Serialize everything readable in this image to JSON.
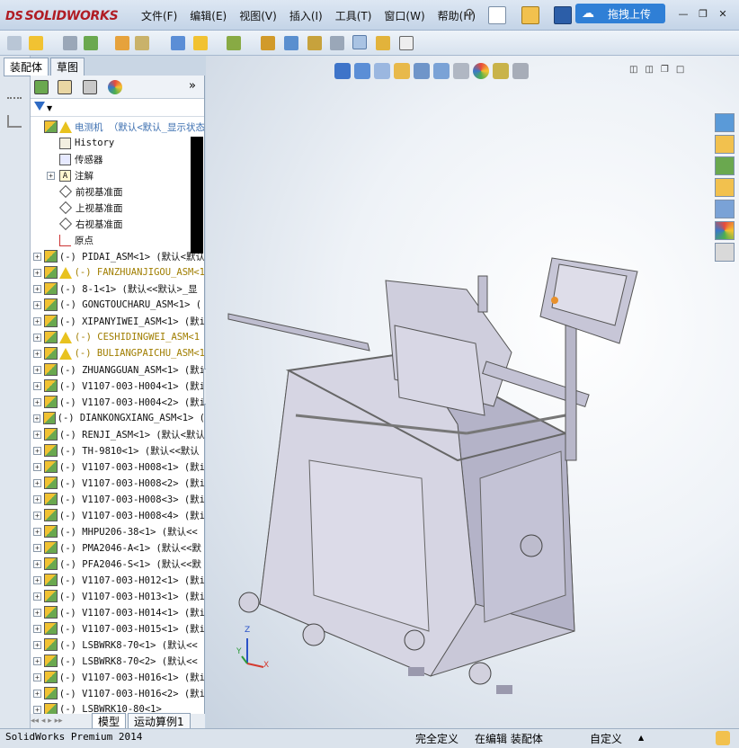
{
  "app": {
    "logo_text": "SOLIDWORKS",
    "logo_mark": "DS"
  },
  "menu": [
    "文件(F)",
    "编辑(E)",
    "视图(V)",
    "插入(I)",
    "工具(T)",
    "窗口(W)",
    "帮助(H)"
  ],
  "upload_button": "拖拽上传",
  "panel_tabs": [
    "装配体",
    "草图"
  ],
  "tree": [
    {
      "text": "电测机  （默认<默认_显示状态",
      "icon": "assembly-warning",
      "plus": false,
      "style": "blue"
    },
    {
      "text": "History",
      "icon": "history",
      "plus": false,
      "indent": 1
    },
    {
      "text": "传感器",
      "icon": "sensor",
      "plus": false,
      "indent": 1
    },
    {
      "text": "注解",
      "icon": "annotation",
      "plus": true,
      "indent": 1
    },
    {
      "text": "前视基准面",
      "icon": "plane",
      "plus": false,
      "indent": 1
    },
    {
      "text": "上视基准面",
      "icon": "plane",
      "plus": false,
      "indent": 1
    },
    {
      "text": "右视基准面",
      "icon": "plane",
      "plus": false,
      "indent": 1
    },
    {
      "text": "原点",
      "icon": "origin",
      "plus": false,
      "indent": 1
    },
    {
      "text": "(-) PIDAI_ASM<1> (默认<默认",
      "icon": "part",
      "plus": true
    },
    {
      "text": "(-) FANZHUANJIGOU_ASM<1",
      "icon": "part-warning",
      "plus": true,
      "style": "yellow"
    },
    {
      "text": "(-) 8-1<1> (默认<<默认>_显",
      "icon": "part",
      "plus": true
    },
    {
      "text": "(-) GONGTOUCHARU_ASM<1> (",
      "icon": "part",
      "plus": true
    },
    {
      "text": "(-) XIPANYIWEI_ASM<1> (默i",
      "icon": "part",
      "plus": true
    },
    {
      "text": "(-) CESHIDINGWEI_ASM<1",
      "icon": "part-warning",
      "plus": true,
      "style": "yellow"
    },
    {
      "text": "(-) BULIANGPAICHU_ASM<1",
      "icon": "part-warning",
      "plus": true,
      "style": "yellow"
    },
    {
      "text": "(-) ZHUANGGUAN_ASM<1> (默i",
      "icon": "part",
      "plus": true
    },
    {
      "text": "(-) V1107-003-H004<1> (默i",
      "icon": "part",
      "plus": true
    },
    {
      "text": "(-) V1107-003-H004<2> (默i",
      "icon": "part",
      "plus": true
    },
    {
      "text": "(-) DIANKONGXIANG_ASM<1> (",
      "icon": "part",
      "plus": true
    },
    {
      "text": "(-) RENJI_ASM<1> (默认<默认",
      "icon": "part",
      "plus": true
    },
    {
      "text": "(-) TH-9810<1> (默认<<默认",
      "icon": "part",
      "plus": true
    },
    {
      "text": "(-) V1107-003-H008<1> (默i",
      "icon": "part",
      "plus": true
    },
    {
      "text": "(-) V1107-003-H008<2> (默i",
      "icon": "part",
      "plus": true
    },
    {
      "text": "(-) V1107-003-H008<3> (默i",
      "icon": "part",
      "plus": true
    },
    {
      "text": "(-) V1107-003-H008<4> (默i",
      "icon": "part",
      "plus": true
    },
    {
      "text": "(-) MHPU206-38<1> (默认<<",
      "icon": "part",
      "plus": true
    },
    {
      "text": "(-) PMA2046-A<1> (默认<<默",
      "icon": "part",
      "plus": true
    },
    {
      "text": "(-) PFA2046-S<1> (默认<<默",
      "icon": "part",
      "plus": true
    },
    {
      "text": "(-) V1107-003-H012<1> (默i",
      "icon": "part",
      "plus": true
    },
    {
      "text": "(-) V1107-003-H013<1> (默i",
      "icon": "part",
      "plus": true
    },
    {
      "text": "(-) V1107-003-H014<1> (默i",
      "icon": "part",
      "plus": true
    },
    {
      "text": "(-) V1107-003-H015<1> (默i",
      "icon": "part",
      "plus": true
    },
    {
      "text": "(-) LSBWRK8-70<1> (默认<<",
      "icon": "part",
      "plus": true
    },
    {
      "text": "(-) LSBWRK8-70<2> (默认<<",
      "icon": "part",
      "plus": true
    },
    {
      "text": "(-) V1107-003-H016<1> (默i",
      "icon": "part",
      "plus": true
    },
    {
      "text": "(-) V1107-003-H016<2> (默i",
      "icon": "part",
      "plus": true
    },
    {
      "text": "(-) LSBWRK10-80<1>",
      "icon": "part",
      "plus": true
    }
  ],
  "bottom_tabs": [
    "模型",
    "运动算例1"
  ],
  "status": {
    "product": "SolidWorks Premium 2014",
    "definition": "完全定义",
    "editing": "在编辑 装配体",
    "units": "自定义"
  },
  "axes": {
    "x": "X",
    "y": "Y",
    "z": "Z"
  }
}
